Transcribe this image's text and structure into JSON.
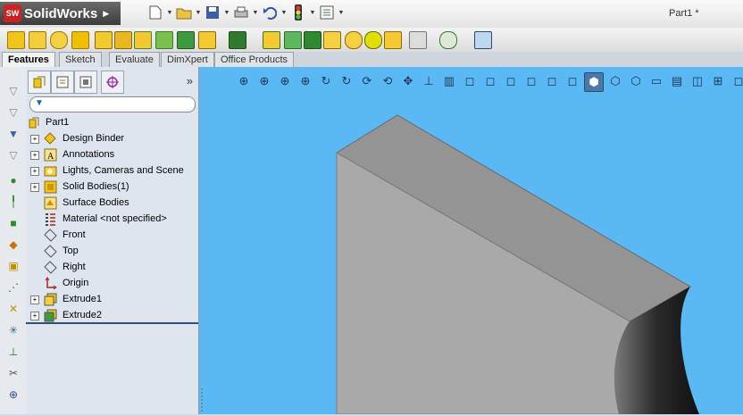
{
  "app": {
    "logo_text": "SolidWorks",
    "document_title": "Part1 *"
  },
  "command_tabs": [
    {
      "label": "Features",
      "active": true
    },
    {
      "label": "Sketch",
      "active": false
    },
    {
      "label": "Evaluate",
      "active": false
    },
    {
      "label": "DimXpert",
      "active": false
    },
    {
      "label": "Office Products",
      "active": false
    }
  ],
  "feature_tree": {
    "root": "Part1",
    "items": [
      {
        "label": "Design Binder",
        "expandable": true,
        "icon": "design-binder-icon"
      },
      {
        "label": "Annotations",
        "expandable": true,
        "icon": "annotations-icon"
      },
      {
        "label": "Lights, Cameras and Scene",
        "expandable": true,
        "icon": "lights-icon"
      },
      {
        "label": "Solid Bodies(1)",
        "expandable": true,
        "icon": "solid-bodies-icon"
      },
      {
        "label": "Surface Bodies",
        "expandable": false,
        "icon": "surface-bodies-icon"
      },
      {
        "label": "Material <not specified>",
        "expandable": false,
        "icon": "material-icon"
      },
      {
        "label": "Front",
        "expandable": false,
        "icon": "plane-icon"
      },
      {
        "label": "Top",
        "expandable": false,
        "icon": "plane-icon"
      },
      {
        "label": "Right",
        "expandable": false,
        "icon": "plane-icon"
      },
      {
        "label": "Origin",
        "expandable": false,
        "icon": "origin-icon"
      },
      {
        "label": "Extrude1",
        "expandable": true,
        "icon": "extrude-icon"
      },
      {
        "label": "Extrude2",
        "expandable": true,
        "icon": "extrude-icon"
      }
    ]
  },
  "colors": {
    "viewport_background": "#5ab9f5",
    "model_top_face": "#949494",
    "model_front_face": "#a9a9a9"
  }
}
